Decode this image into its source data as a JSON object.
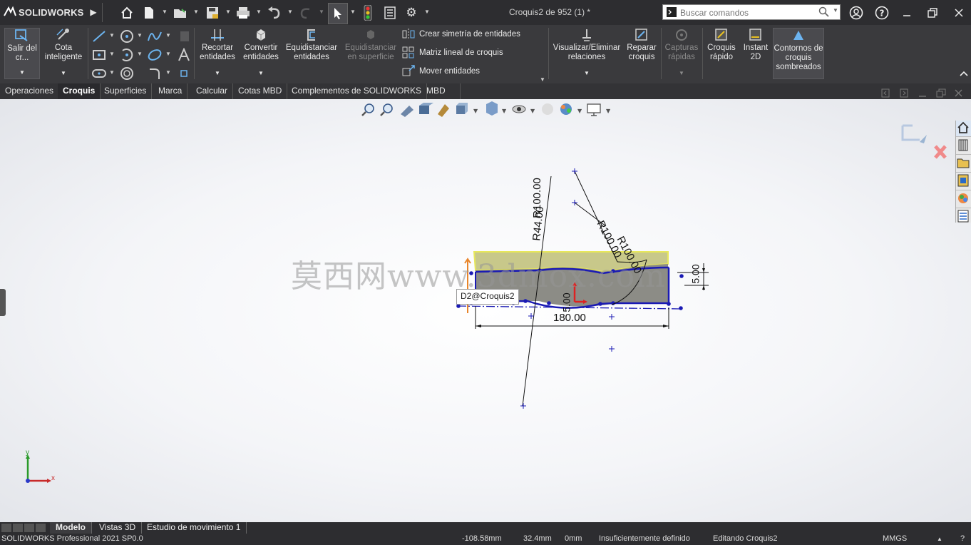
{
  "app": {
    "brand": "SOLIDWORKS",
    "document_title": "Croquis2 de 952 (1) *"
  },
  "search": {
    "placeholder": "Buscar comandos"
  },
  "ribbon": {
    "exit_sketch": "Salir del cr...",
    "smart_dimension": "Cota inteligente",
    "trim": "Recortar entidades",
    "convert": "Convertir entidades",
    "offset": "Equidistanciar entidades",
    "offset_surface": "Equidistanciar en superficie",
    "mirror": "Crear simetría de entidades",
    "linear_pattern": "Matriz lineal de croquis",
    "move": "Mover entidades",
    "display_relations": "Visualizar/Eliminar relaciones",
    "repair": "Reparar croquis",
    "quick_snaps": "Capturas rápidas",
    "rapid_sketch": "Croquis rápido",
    "instant2d": "Instant 2D",
    "shaded_contours": "Contornos de croquis sombreados"
  },
  "command_tabs": [
    "Operaciones",
    "Croquis",
    "Superficies",
    "Marca",
    "Calcular",
    "Cotas MBD",
    "Complementos de SOLIDWORKS",
    "MBD"
  ],
  "active_command_tab": "Croquis",
  "sketch": {
    "dimensions": {
      "r100_vertical": "R100.00",
      "r44": "R44.00",
      "r100_a": "R100.00",
      "r100_b": "R100.00",
      "width": "180.00",
      "height": "5.00",
      "small": "5.00"
    },
    "tooltip": "D2@Croquis2",
    "watermark": "莫西网www.3dmox.com",
    "axis_x": "x",
    "axis_y": "y"
  },
  "bottom_tabs": [
    "Modelo",
    "Vistas 3D",
    "Estudio de movimiento 1"
  ],
  "active_bottom_tab": "Modelo",
  "status": {
    "product": "SOLIDWORKS Professional 2021 SP0.0",
    "x": "-108.58mm",
    "y": "32.4mm",
    "z": "0mm",
    "definition": "Insuficientemente definido",
    "mode": "Editando Croquis2",
    "units": "MMGS"
  },
  "colors": {
    "sketch_blue": "#1a1ab4",
    "selection_yellow": "#e8e85a",
    "region_gray": "#8c8c86",
    "dark_ui": "#2d2d30"
  }
}
